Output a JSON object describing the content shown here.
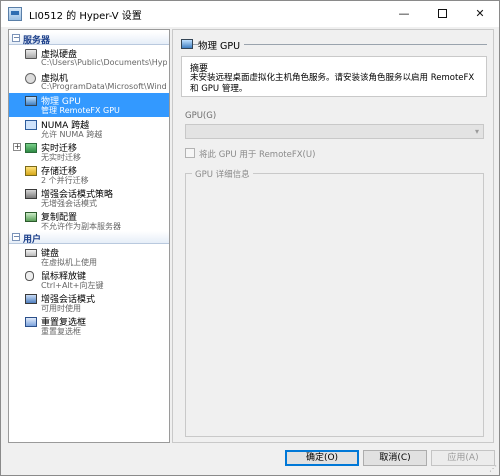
{
  "window": {
    "title": "LI0512 的 Hyper-V 设置",
    "controls": {
      "minimize": "—",
      "close": "✕"
    }
  },
  "sidebar": {
    "sections": [
      {
        "label": "服务器",
        "toggle": "−"
      },
      {
        "label": "用户",
        "toggle": "−"
      }
    ],
    "server_items": [
      {
        "title": "虚拟硬盘",
        "subtitle": "C:\\Users\\Public\\Documents\\Hyper-...",
        "icon": "disk-icon"
      },
      {
        "title": "虚拟机",
        "subtitle": "C:\\ProgramData\\Microsoft\\Windo...",
        "icon": "dvd-icon"
      },
      {
        "title": "物理 GPU",
        "subtitle": "管理 RemoteFX GPU",
        "icon": "gpu-icon",
        "selected": true
      },
      {
        "title": "NUMA 跨越",
        "subtitle": "允许 NUMA 跨越",
        "icon": "numa-icon"
      },
      {
        "title": "实时迁移",
        "subtitle": "无实时迁移",
        "icon": "live-migration-icon",
        "expander": "+"
      },
      {
        "title": "存储迁移",
        "subtitle": "2 个并行迁移",
        "icon": "storage-migration-icon"
      },
      {
        "title": "增强会话模式策略",
        "subtitle": "无增强会话模式",
        "icon": "session-policy-icon"
      },
      {
        "title": "复制配置",
        "subtitle": "不允许作为副本服务器",
        "icon": "replication-icon"
      }
    ],
    "user_items": [
      {
        "title": "键盘",
        "subtitle": "在虚拟机上使用",
        "icon": "keyboard-icon"
      },
      {
        "title": "鼠标释放键",
        "subtitle": "Ctrl+Alt+向左键",
        "icon": "mouse-icon"
      },
      {
        "title": "增强会话模式",
        "subtitle": "可用时使用",
        "icon": "enhanced-session-icon"
      },
      {
        "title": "重置复选框",
        "subtitle": "重置复选框",
        "icon": "reset-checkbox-icon"
      }
    ]
  },
  "pane": {
    "title": "物理 GPU",
    "summary_label": "摘要",
    "summary_text": "未安装远程桌面虚拟化主机角色服务。请安装该角色服务以启用 RemoteFX 和 GPU 管理。",
    "gpu_label": "GPU(G)",
    "gpu_value": "",
    "checkbox_label": "将此 GPU 用于 RemoteFX(U)",
    "details_legend": "GPU 详细信息"
  },
  "buttons": {
    "ok": "确定(O)",
    "cancel": "取消(C)",
    "apply": "应用(A)"
  }
}
